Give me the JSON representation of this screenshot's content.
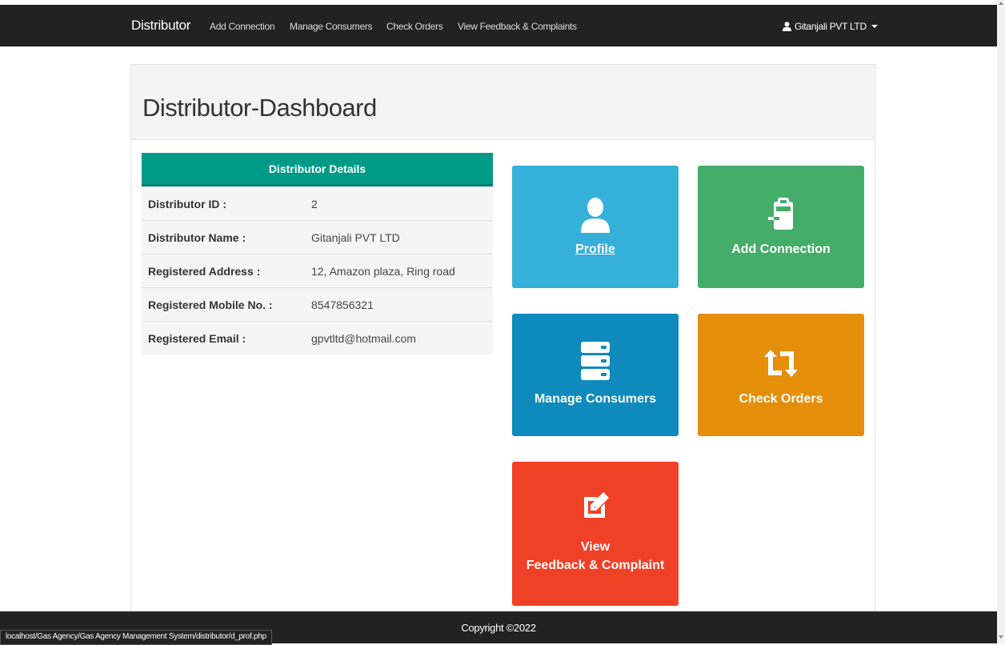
{
  "navbar": {
    "brand": "Distributor",
    "links": [
      "Add Connection",
      "Manage Consumers",
      "Check Orders",
      "View Feedback & Complaints"
    ],
    "user": "Gitanjali PVT LTD"
  },
  "page": {
    "title": "Distributor-Dashboard"
  },
  "details": {
    "heading": "Distributor Details",
    "rows": [
      {
        "label": "Distributor ID :",
        "value": "2"
      },
      {
        "label": "Distributor Name :",
        "value": "Gitanjali PVT LTD"
      },
      {
        "label": "Registered Address :",
        "value": "12, Amazon plaza, Ring road"
      },
      {
        "label": "Registered Mobile No. :",
        "value": "8547856321"
      },
      {
        "label": "Registered Email :",
        "value": "gpvtltd@hotmail.com"
      }
    ]
  },
  "tiles": {
    "profile": {
      "label": "Profile",
      "color": "#34b0d9",
      "icon": "user-icon"
    },
    "add_connection": {
      "label": "Add Connection",
      "color": "#45ad6a",
      "icon": "clipboard-arrow-icon"
    },
    "manage_consumers": {
      "label": "Manage Consumers",
      "color": "#0f8abd",
      "icon": "server-stack-icon"
    },
    "check_orders": {
      "label": "Check Orders",
      "color": "#e58e0a",
      "icon": "retweet-icon"
    },
    "feedback": {
      "label_line1": "View",
      "label_line2": "Feedback & Complaint",
      "color": "#f04126",
      "icon": "edit-icon"
    }
  },
  "footer": {
    "copyright": "Copyright ©2022"
  },
  "status_bar": {
    "url": "localhost/Gas Agency/Gas Agency Management System/distributor/d_prof.php"
  }
}
